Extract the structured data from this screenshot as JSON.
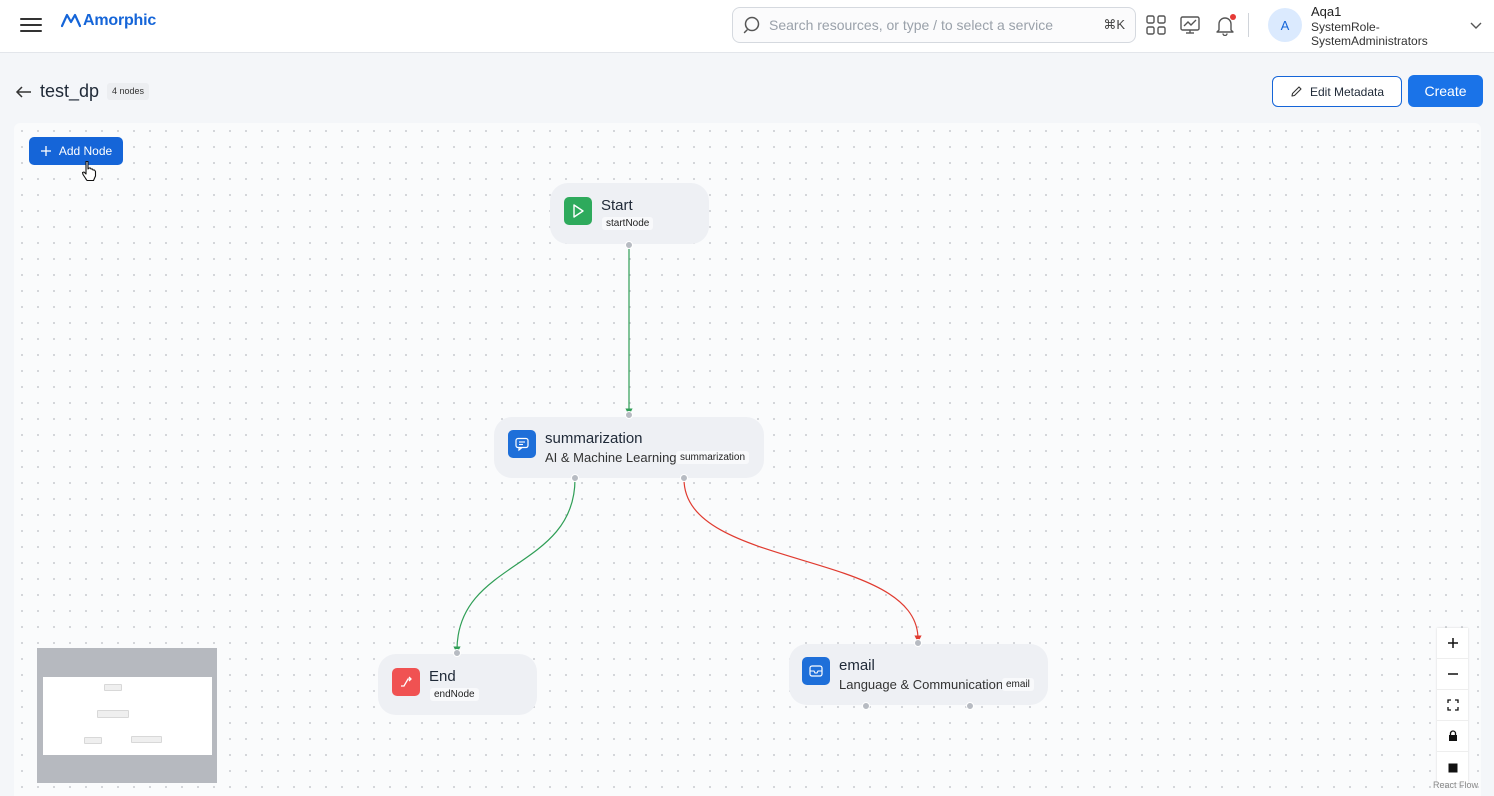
{
  "navbar": {
    "brand": "Amorphic",
    "search_placeholder": "Search resources, or type / to select a service",
    "search_shortcut": "⌘K",
    "icons": [
      "menu-icon",
      "apps-grid-icon",
      "analytics-icon",
      "bell-icon",
      "chevron-down-icon"
    ],
    "user": {
      "avatar_letter": "A",
      "name": "Aqa1",
      "role": "SystemRole-SystemAdministrators"
    }
  },
  "header": {
    "title": "test_dp",
    "node_count_badge": "4 nodes",
    "edit_metadata_label": "Edit Metadata",
    "create_label": "Create"
  },
  "canvas": {
    "add_node_label": "Add Node",
    "attribution": "React Flow",
    "nodes": [
      {
        "id": "start",
        "title": "Start",
        "tag": "startNode",
        "icon": "play-icon",
        "icon_color": "#2eaa5c"
      },
      {
        "id": "summarization",
        "title": "summarization",
        "subtitle": "AI & Machine Learning",
        "tag": "summarization",
        "icon": "chat-ai-icon",
        "icon_color": "#1e6fd9"
      },
      {
        "id": "end",
        "title": "End",
        "tag": "endNode",
        "icon": "end-icon",
        "icon_color": "#f05252"
      },
      {
        "id": "email",
        "title": "email",
        "subtitle": "Language & Communication",
        "tag": "email",
        "icon": "email-icon",
        "icon_color": "#1e6fd9"
      }
    ],
    "edges": [
      {
        "from": "start",
        "to": "summarization",
        "color": "#2f9e56"
      },
      {
        "from": "summarization",
        "to": "end",
        "color": "#2f9e56"
      },
      {
        "from": "summarization",
        "to": "email",
        "color": "#e03b30"
      }
    ],
    "controls": [
      "zoom-in-icon",
      "zoom-out-icon",
      "fit-view-icon",
      "lock-icon",
      "interactive-toggle-icon"
    ]
  }
}
